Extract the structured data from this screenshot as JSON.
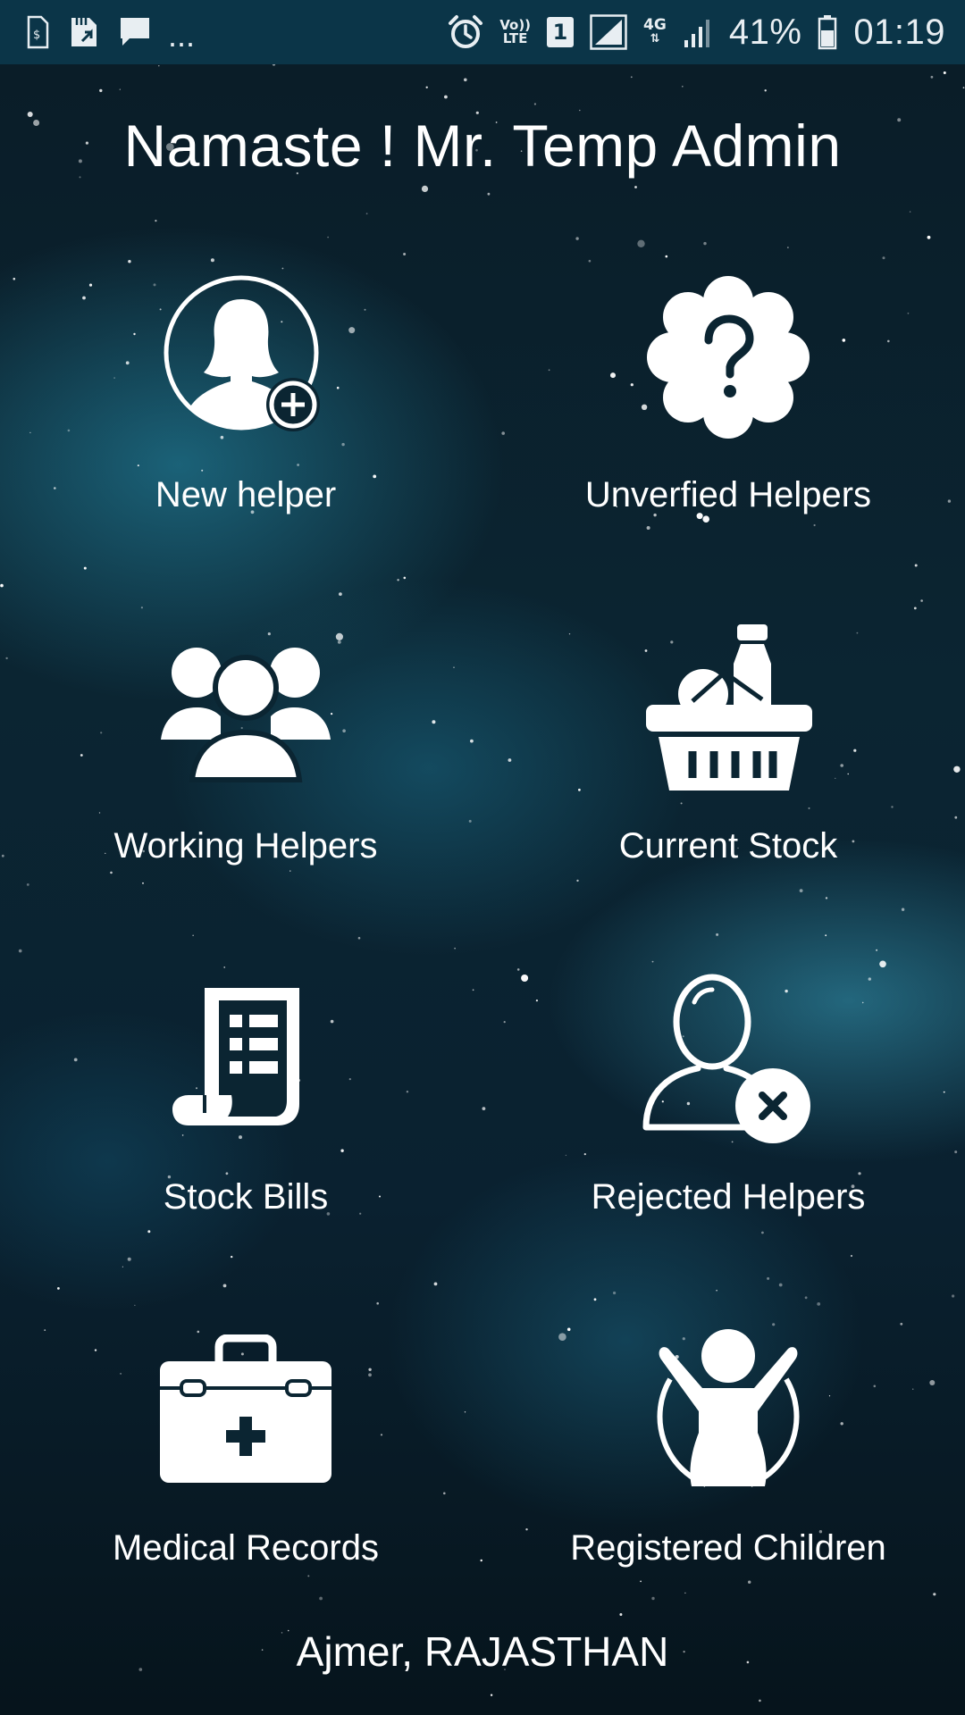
{
  "status_bar": {
    "left_icons": [
      "sim-toolkit-icon",
      "sd-card-icon",
      "message-icon"
    ],
    "overflow": "...",
    "volte_top": "Vo))",
    "volte_bottom": "LTE",
    "sim_slot": "1",
    "network_type": "4G",
    "battery_percent": "41%",
    "time": "01:19"
  },
  "greeting": "Namaste ! Mr. Temp Admin",
  "menu": [
    {
      "label": "New helper",
      "icon": "add-helper-icon"
    },
    {
      "label": "Unverfied Helpers",
      "icon": "question-badge-icon"
    },
    {
      "label": "Working Helpers",
      "icon": "group-icon"
    },
    {
      "label": "Current Stock",
      "icon": "grocery-basket-icon"
    },
    {
      "label": "Stock Bills",
      "icon": "bill-scroll-icon"
    },
    {
      "label": "Rejected Helpers",
      "icon": "reject-user-icon"
    },
    {
      "label": "Medical Records",
      "icon": "medical-kit-icon"
    },
    {
      "label": "Registered Children",
      "icon": "child-icon"
    }
  ],
  "location": "Ajmer, RAJASTHAN",
  "colors": {
    "status_bar": "#0b3548",
    "background": "#0a2130",
    "text": "#ffffff"
  }
}
